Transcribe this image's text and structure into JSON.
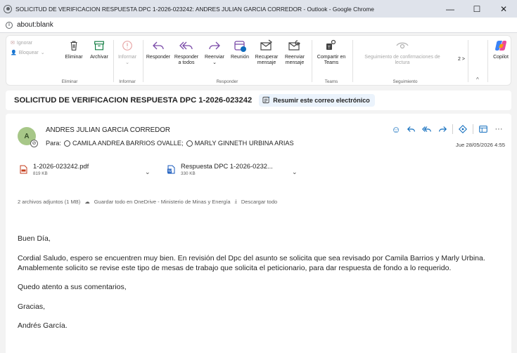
{
  "window": {
    "title": "SOLICITUD DE VERIFICACION RESPUESTA DPC 1-2026-023242: ANDRES JULIAN GARCIA CORREDOR - Outlook - Google Chrome",
    "minimize": "—",
    "maximize": "☐",
    "close": "✕"
  },
  "address": {
    "url": "about:blank"
  },
  "ribbon": {
    "eliminar_group": {
      "ignorar": "Ignorar",
      "bloquear": "Bloquear",
      "eliminar": "Eliminar",
      "archivar": "Archivar",
      "label": "Eliminar"
    },
    "informar_group": {
      "informar": "Informar",
      "label": "Informar"
    },
    "responder_group": {
      "responder": "Responder",
      "responder_todos": "Responder a todos",
      "reenviar": "Reenviar",
      "reunion": "Reunión",
      "recuperar": "Recuperar mensaje",
      "reenviar_mensaje": "Reenviar mensaje",
      "label": "Responder"
    },
    "teams_group": {
      "compartir": "Compartir en Teams",
      "label": "Teams"
    },
    "seguimiento_group": {
      "seguimiento": "Seguimiento de confirmaciones de lectura",
      "label": "Seguimiento"
    },
    "more": "2 >",
    "copilot": "Copilot"
  },
  "subject": {
    "text": "SOLICITUD DE VERIFICACION RESPUESTA DPC 1-2026-023242",
    "summarize": "Resumir este correo electrónico"
  },
  "message": {
    "avatar_initial": "A",
    "sender": "ANDRES JULIAN GARCIA CORREDOR",
    "to_label": "Para:",
    "recipients": [
      "CAMILA ANDREA BARRIOS OVALLE;",
      "MARLY GINNETH URBINA ARIAS"
    ],
    "date": "Jue 28/05/2026 4:55",
    "attachments": [
      {
        "name": "1-2026-023242.pdf",
        "size": "819 KB"
      },
      {
        "name": "Respuesta DPC 1-2026-0232...",
        "size": "330 KB"
      }
    ],
    "attachments_summary": {
      "count": "2 archivos adjuntos (1 MB)",
      "save_onedrive": "Guardar todo en OneDrive - Ministerio de Minas y Energía",
      "download": "Descargar todo"
    },
    "body": {
      "greeting": "Buen Día,",
      "paragraph": "Cordial Saludo, espero se encuentren muy bien. En revisión del Dpc del asunto se solicita que sea revisado por Camila Barrios y Marly Urbina. Amablemente solicito se revise este tipo de mesas de trabajo que solicita el peticionario, para dar respuesta de fondo a lo requerido.",
      "closing": "Quedo atento a sus comentarios,",
      "thanks": "Gracias,",
      "signature": "Andrés García."
    }
  },
  "colors": {
    "accent": "#0f6cbd",
    "avatar_bg": "#a7c788"
  }
}
